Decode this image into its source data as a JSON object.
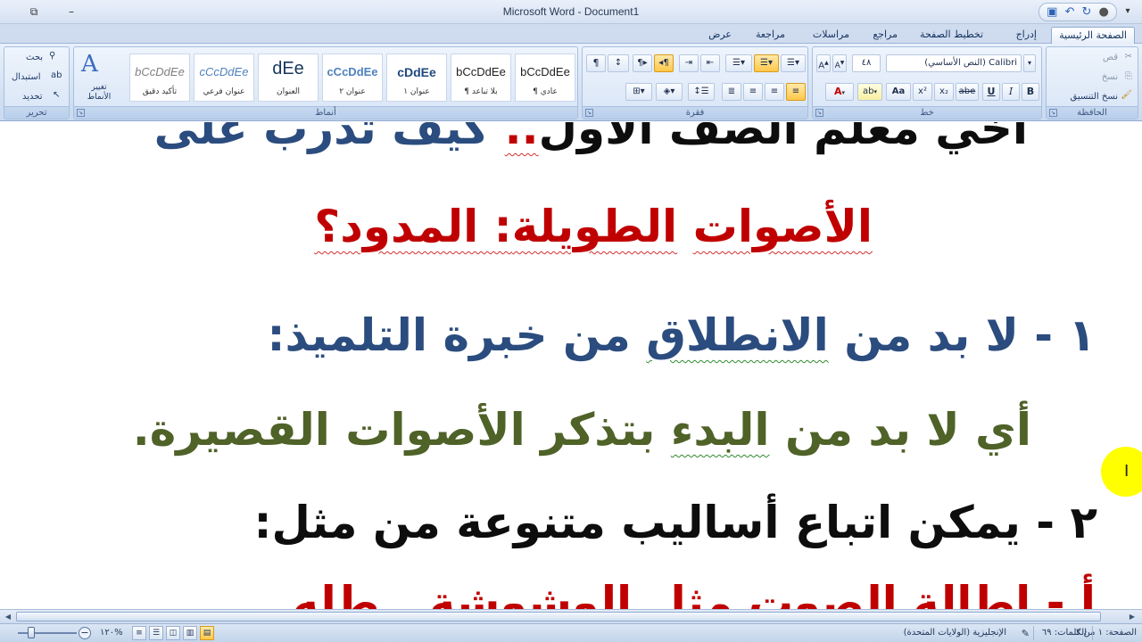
{
  "window": {
    "title": "Microsoft Word - Document1",
    "restore_icon": "restore-window-icon",
    "minimize_icon": "minimize-icon"
  },
  "qat": {
    "save_icon": "save-icon",
    "undo_icon": "undo-icon",
    "redo_icon": "redo-icon"
  },
  "tabs": [
    "الصفحة الرئيسية",
    "إدراج",
    "تخطيط الصفحة",
    "مراجع",
    "مراسلات",
    "مراجعة",
    "عرض"
  ],
  "ribbon": {
    "clipboard": {
      "label": "الحافظة",
      "cut": "قص",
      "copy": "نسخ",
      "format_painter": "نسخ التنسيق"
    },
    "font": {
      "label": "خط",
      "font_name": "Calibri (النص الأساسي)",
      "font_size": "٤٨",
      "bold": "B",
      "italic": "I",
      "underline": "U",
      "strike": "abe",
      "subscript": "x₂",
      "superscript": "x²",
      "change_case": "Aa",
      "grow": "A",
      "shrink": "A"
    },
    "paragraph": {
      "label": "فقرة"
    },
    "styles": {
      "label": "أنماط",
      "change_styles": "تغيير الأنماط",
      "items": [
        {
          "sample": "bCcDdEe",
          "name": "¶ عادي"
        },
        {
          "sample": "bCcDdEe",
          "name": "¶ بلا تباعد"
        },
        {
          "sample": "cDdEe",
          "name": "عنوان ١"
        },
        {
          "sample": "cCcDdEe",
          "name": "عنوان ٢"
        },
        {
          "sample": "dEe",
          "name": "العنوان"
        },
        {
          "sample": "cCcDdEe",
          "name": "عنوان فرعي"
        },
        {
          "sample": "bCcDdEe",
          "name": "تأكيد دقيق"
        }
      ]
    },
    "editing": {
      "label": "تحرير",
      "find": "بحث",
      "replace": "استبدال",
      "select": "تحديد"
    }
  },
  "document": {
    "line1": {
      "parts": [
        "أخي معلم الصف الأول",
        "..",
        " كيف تدرب على"
      ]
    },
    "line2": {
      "parts": [
        "الأصوات",
        " ",
        "الطويلة",
        ": المدود؟"
      ]
    },
    "line3": {
      "parts": [
        "١ - لا بد من ",
        "الانطلاق",
        " من خبرة التلميذ:"
      ]
    },
    "line4": {
      "parts": [
        "أي لا بد من ",
        "البدء",
        " بتذكر الأصوات القصيرة."
      ]
    },
    "line5": {
      "text": "٢ - يمكن اتباع أساليب متنوعة من مثل:"
    },
    "line6": {
      "text": "أ - إطالة الصوت مثل الوشوشة.. طله"
    }
  },
  "colors": {
    "blue_text": "#2b4c7e",
    "red_text": "#c00000",
    "olive_text": "#4f6228",
    "black_text": "#0d0d0d"
  },
  "status": {
    "page": "الصفحة: ١ من ٢",
    "words": "الكلمات: ٦٩",
    "language": "الإنجليزية (الولايات المتحدة)",
    "zoom": "١٢٠%",
    "proof_icon": "proofing-icon"
  }
}
